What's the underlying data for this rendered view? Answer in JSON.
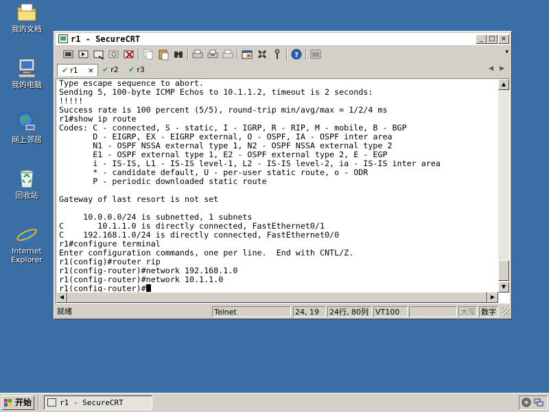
{
  "desktop": {
    "icons": [
      {
        "label": "我的文档",
        "icon": "my-documents-icon"
      },
      {
        "label": "我的电脑",
        "icon": "my-computer-icon"
      },
      {
        "label": "网上邻居",
        "icon": "network-places-icon"
      },
      {
        "label": "回收站",
        "icon": "recycle-bin-icon"
      },
      {
        "label_line1": "Internet",
        "label_line2": "Explorer",
        "icon": "internet-explorer-icon"
      }
    ],
    "background_color": "#3a6ea5"
  },
  "window": {
    "title": "r1 - SecureCRT",
    "caption_buttons": {
      "minimize": "_",
      "maximize": "□",
      "close": "×"
    }
  },
  "toolbar": {
    "buttons": [
      "connect-icon",
      "quick-connect-icon",
      "connect-tab-icon",
      "reconnect-icon",
      "disconnect-icon",
      "copy-icon",
      "paste-icon",
      "find-icon",
      "print-icon",
      "print-selection-icon",
      "print-setup-icon",
      "session-options-icon",
      "global-options-icon",
      "key-map-icon",
      "help-icon",
      "sftp-icon"
    ]
  },
  "tabs": [
    {
      "label": "r1",
      "active": true,
      "close": "×"
    },
    {
      "label": "r2",
      "active": false
    },
    {
      "label": "r3",
      "active": false
    }
  ],
  "terminal": {
    "lines": [
      "Type escape sequence to abort.",
      "Sending 5, 100-byte ICMP Echos to 10.1.1.2, timeout is 2 seconds:",
      "!!!!!",
      "Success rate is 100 percent (5/5), round-trip min/avg/max = 1/2/4 ms",
      "r1#show ip route",
      "Codes: C - connected, S - static, I - IGRP, R - RIP, M - mobile, B - BGP",
      "       D - EIGRP, EX - EIGRP external, O - OSPF, IA - OSPF inter area",
      "       N1 - OSPF NSSA external type 1, N2 - OSPF NSSA external type 2",
      "       E1 - OSPF external type 1, E2 - OSPF external type 2, E - EGP",
      "       i - IS-IS, L1 - IS-IS level-1, L2 - IS-IS level-2, ia - IS-IS inter area",
      "       * - candidate default, U - per-user static route, o - ODR",
      "       P - periodic downloaded static route",
      "",
      "Gateway of last resort is not set",
      "",
      "     10.0.0.0/24 is subnetted, 1 subnets",
      "C       10.1.1.0 is directly connected, FastEthernet0/1",
      "C    192.168.1.0/24 is directly connected, FastEthernet0/0",
      "r1#configure terminal",
      "Enter configuration commands, one per line.  End with CNTL/Z.",
      "r1(config)#router rip",
      "r1(config-router)#network 192.168.1.0",
      "r1(config-router)#network 10.1.1.0",
      "r1(config-router)#"
    ]
  },
  "statusbar": {
    "ready": "就绪",
    "protocol": "Telnet",
    "cursor_pos": "24, 19",
    "rows_cols": "24行, 80列",
    "emulation": "VT100",
    "caps": "大写",
    "num": "数字"
  },
  "taskbar": {
    "start_label": "开始",
    "task_title": "r1 - SecureCRT"
  }
}
